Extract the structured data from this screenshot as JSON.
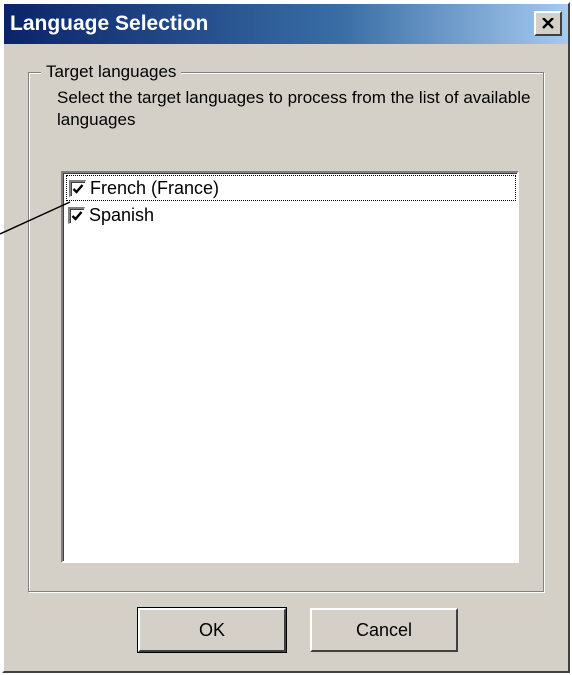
{
  "window": {
    "title": "Language Selection",
    "close_icon": "close-x-icon"
  },
  "group": {
    "legend": "Target languages",
    "description": "Select the target languages to process from the list of available languages"
  },
  "languages": [
    {
      "label": "French (France)",
      "checked": true,
      "focused": true
    },
    {
      "label": "Spanish",
      "checked": true,
      "focused": false
    }
  ],
  "buttons": {
    "ok": "OK",
    "cancel": "Cancel"
  },
  "colors": {
    "title_gradient_start": "#0a246a",
    "title_gradient_end": "#a6caf0",
    "dialog_face": "#d4d0c8"
  }
}
